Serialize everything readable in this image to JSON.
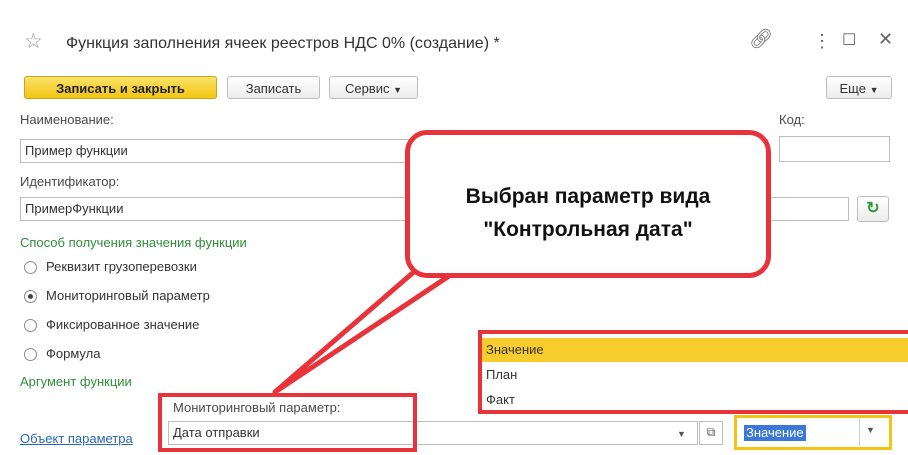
{
  "window": {
    "title": "Функция заполнения ячеек реестров НДС 0% (создание) *"
  },
  "toolbar": {
    "save_close": "Записать и закрыть",
    "save": "Записать",
    "service": "Сервис",
    "more": "Еще"
  },
  "form": {
    "name_label": "Наименование:",
    "name_value": "Пример функции",
    "code_label": "Код:",
    "code_value": "",
    "id_label": "Идентификатор:",
    "id_value": "ПримерФункции",
    "method_section": "Способ получения значения функции",
    "radios": [
      {
        "label": "Реквизит грузоперевозки",
        "checked": false
      },
      {
        "label": "Мониторинговый параметр",
        "checked": true
      },
      {
        "label": "Фиксированное значение",
        "checked": false
      },
      {
        "label": "Формула",
        "checked": false
      }
    ],
    "arg_section": "Аргумент функции",
    "monitor_label": "Мониторинговый параметр:",
    "monitor_value": "Дата отправки",
    "object_link": "Объект параметра",
    "value_select": "Значение"
  },
  "dropdown": {
    "options": [
      "Значение",
      "План",
      "Факт"
    ],
    "selected": "Значение"
  },
  "callout": {
    "line1": "Выбран параметр вида",
    "line2": "\"Контрольная дата\""
  },
  "colors": {
    "accent_red": "#e8333a",
    "primary_yellow": "#f2c512",
    "section_green": "#2f8f3a",
    "highlight_yellow": "#f7cc2d"
  }
}
